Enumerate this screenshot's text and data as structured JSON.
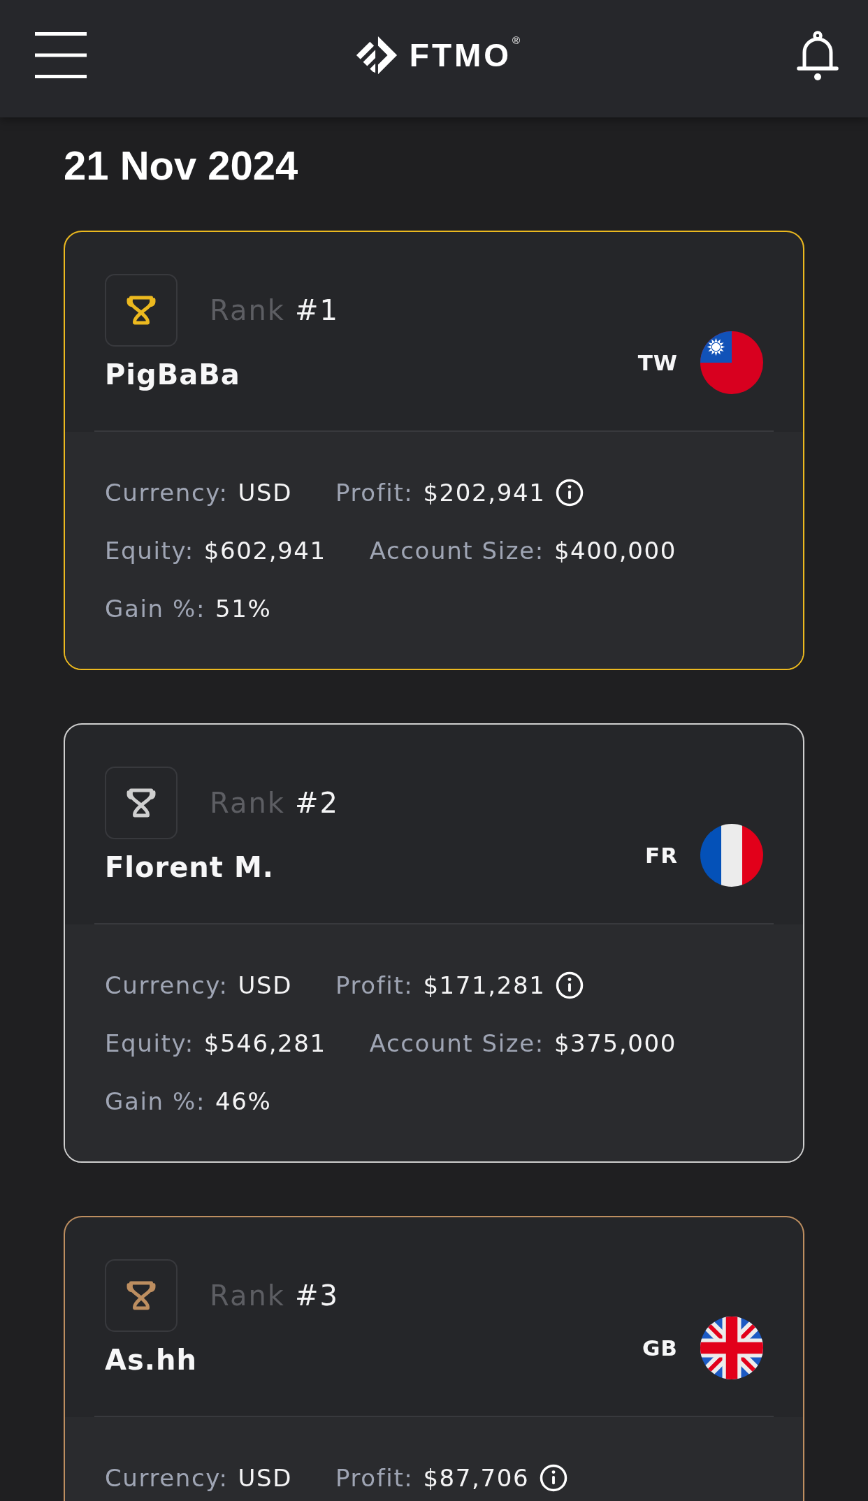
{
  "header": {
    "logo": "FTMO$^{®}$"
  },
  "date": "21 Nov 2024",
  "cards": [
    {
      "color": "#ecb91f",
      "rank_label": "Rank",
      "rank": "#1",
      "name": "PigBaBa",
      "country": "TW",
      "flag": {
        "kind": "tw"
      },
      "stats": [
        {
          "kind": "plain",
          "label": "Currency:",
          "value": "USD"
        },
        {
          "kind": "info",
          "label": "Profit:",
          "value": "$202,941"
        },
        {
          "kind": "plain",
          "label": "Equity:",
          "value": "$602,941"
        },
        {
          "kind": "plain",
          "label": "Account Size:",
          "value": "$400,000"
        },
        {
          "kind": "plain",
          "label": "Gain %:",
          "value": "51%"
        }
      ]
    },
    {
      "color": "#cfcfcf",
      "rank_label": "Rank",
      "rank": "#2",
      "name": "Florent M.",
      "country": "FR",
      "flag": {
        "kind": "fr"
      },
      "stats": [
        {
          "kind": "plain",
          "label": "Currency:",
          "value": "USD"
        },
        {
          "kind": "info",
          "label": "Profit:",
          "value": "$171,281"
        },
        {
          "kind": "plain",
          "label": "Equity:",
          "value": "$546,281"
        },
        {
          "kind": "plain",
          "label": "Account Size:",
          "value": "$375,000"
        },
        {
          "kind": "plain",
          "label": "Gain %:",
          "value": "46%"
        }
      ]
    },
    {
      "color": "#bd8e60",
      "rank_label": "Rank",
      "rank": "#3",
      "name": "As.hh",
      "country": "GB",
      "flag": {
        "kind": "gb"
      },
      "stats": [
        {
          "kind": "plain",
          "label": "Currency:",
          "value": "USD"
        },
        {
          "kind": "info",
          "label": "Profit:",
          "value": "$87,706"
        }
      ]
    }
  ]
}
